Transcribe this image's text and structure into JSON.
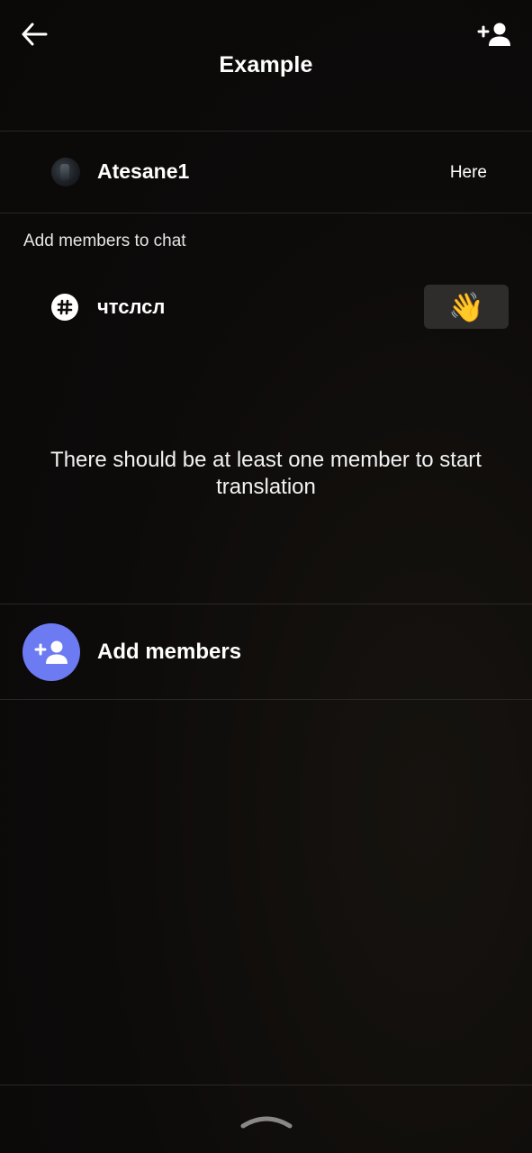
{
  "header": {
    "title": "Example",
    "back_icon": "arrow-left-icon",
    "add_user_icon": "person-add-icon"
  },
  "member": {
    "name": "Atesane1",
    "status": "Here"
  },
  "add_section": {
    "label": "Add members to chat",
    "channel_name": "чтслсл",
    "wave_emoji": "👋"
  },
  "notice": "There should be at least one member to start translation",
  "add_members": {
    "label": "Add members"
  },
  "colors": {
    "accent": "#6c7bf2",
    "background": "#0e0c0b",
    "divider": "#2a2726",
    "wave_button": "#2e2d2c"
  }
}
